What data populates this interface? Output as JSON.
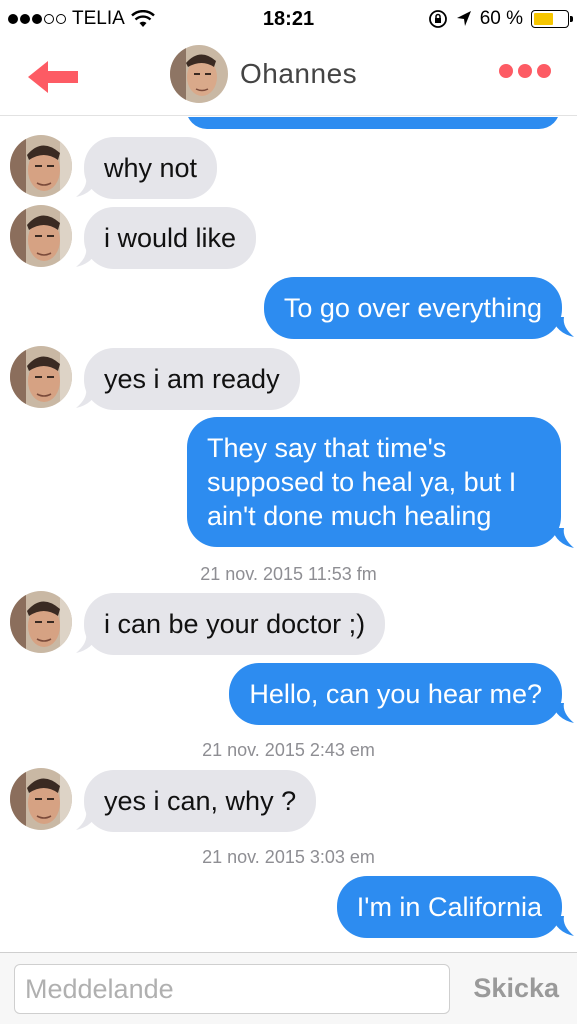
{
  "status_bar": {
    "carrier": "TELIA",
    "time": "18:21",
    "battery_percent": "60 %",
    "battery_level": 0.6,
    "signal_bars": 3,
    "signal_total": 5
  },
  "header": {
    "contact_name": "Ohannes"
  },
  "colors": {
    "accent": "#fd5b64",
    "outgoing_bubble": "#2d8cf0",
    "incoming_bubble": "#e5e5ea"
  },
  "messages": [
    {
      "type": "in",
      "text": "why not"
    },
    {
      "type": "in",
      "text": "i would like"
    },
    {
      "type": "out",
      "text": "To go over everything"
    },
    {
      "type": "in",
      "text": "yes i am ready"
    },
    {
      "type": "out",
      "text": "They say that time's supposed to heal ya, but I ain't done much healing"
    },
    {
      "type": "timestamp",
      "text": "21 nov. 2015 11:53 fm"
    },
    {
      "type": "in",
      "text": "i can be your doctor ;)"
    },
    {
      "type": "out",
      "text": "Hello, can you hear me?"
    },
    {
      "type": "timestamp",
      "text": "21 nov. 2015 2:43 em"
    },
    {
      "type": "in",
      "text": "yes i can, why ?"
    },
    {
      "type": "timestamp",
      "text": "21 nov. 2015 3:03 em"
    },
    {
      "type": "out",
      "text": "I'm in California"
    }
  ],
  "composer": {
    "placeholder": "Meddelande",
    "send_label": "Skicka"
  },
  "icons": {
    "back": "back-arrow-icon",
    "more": "more-dots-icon",
    "wifi": "wifi-icon",
    "rotation_lock": "rotation-lock-icon",
    "location": "location-arrow-icon"
  }
}
